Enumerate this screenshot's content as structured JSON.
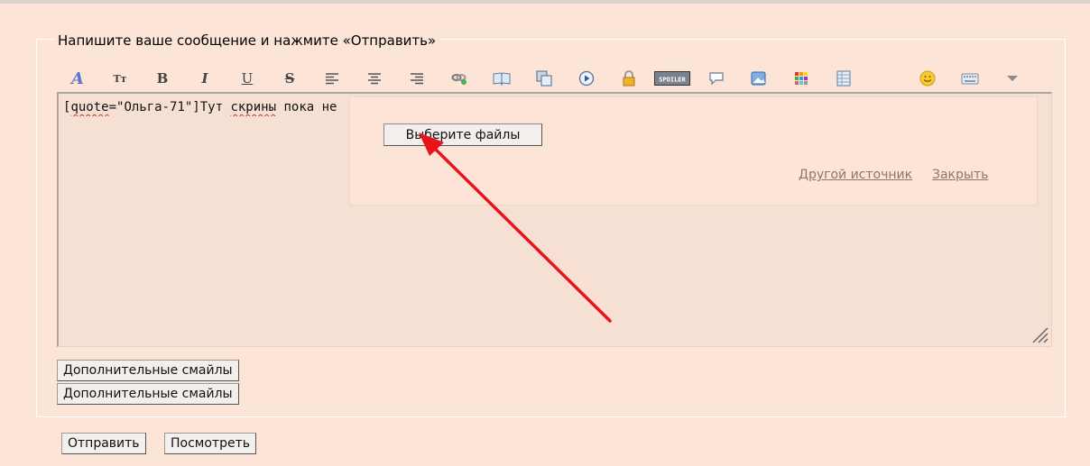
{
  "form": {
    "legend": "Напишите ваше сообщение и нажмите «Отправить»",
    "editor_text_parts": [
      "[",
      "quote",
      "=\"Ольга-71\"]Тут ",
      "скрины",
      " пока не"
    ],
    "upload": {
      "choose_files_label": "Выберите файлы",
      "other_source_label": "Другой источник",
      "close_label": "Закрыть"
    },
    "smiles_button_1": "Дополнительные смайлы",
    "smiles_button_2": "Дополнительные смайлы",
    "submit_label": "Отправить",
    "preview_label": "Посмотреть"
  },
  "toolbar": {
    "icons": [
      "font-color-icon",
      "font-size-icon",
      "bold-icon",
      "italic-icon",
      "underline-icon",
      "strikethrough-icon",
      "align-left-icon",
      "align-center-icon",
      "align-right-icon",
      "link-icon",
      "quote-book-icon",
      "code-copy-icon",
      "video-play-icon",
      "hide-lock-icon",
      "spoiler-icon",
      "comment-bubble-icon",
      "image-icon",
      "color-palette-icon",
      "table-icon",
      "smiley-icon",
      "keyboard-icon",
      "more-dropdown-icon"
    ],
    "bold_glyph": "B",
    "italic_glyph": "I",
    "underline_glyph": "U",
    "strike_glyph": "S",
    "font_size_glyph": "Tт",
    "font_color_glyph": "A",
    "spoiler_glyph": "SPOILER"
  },
  "colors": {
    "background": "#fce5d6",
    "editor_background": "#f6e0d3",
    "link": "#8d7766",
    "annotation_arrow": "#e8141c"
  }
}
